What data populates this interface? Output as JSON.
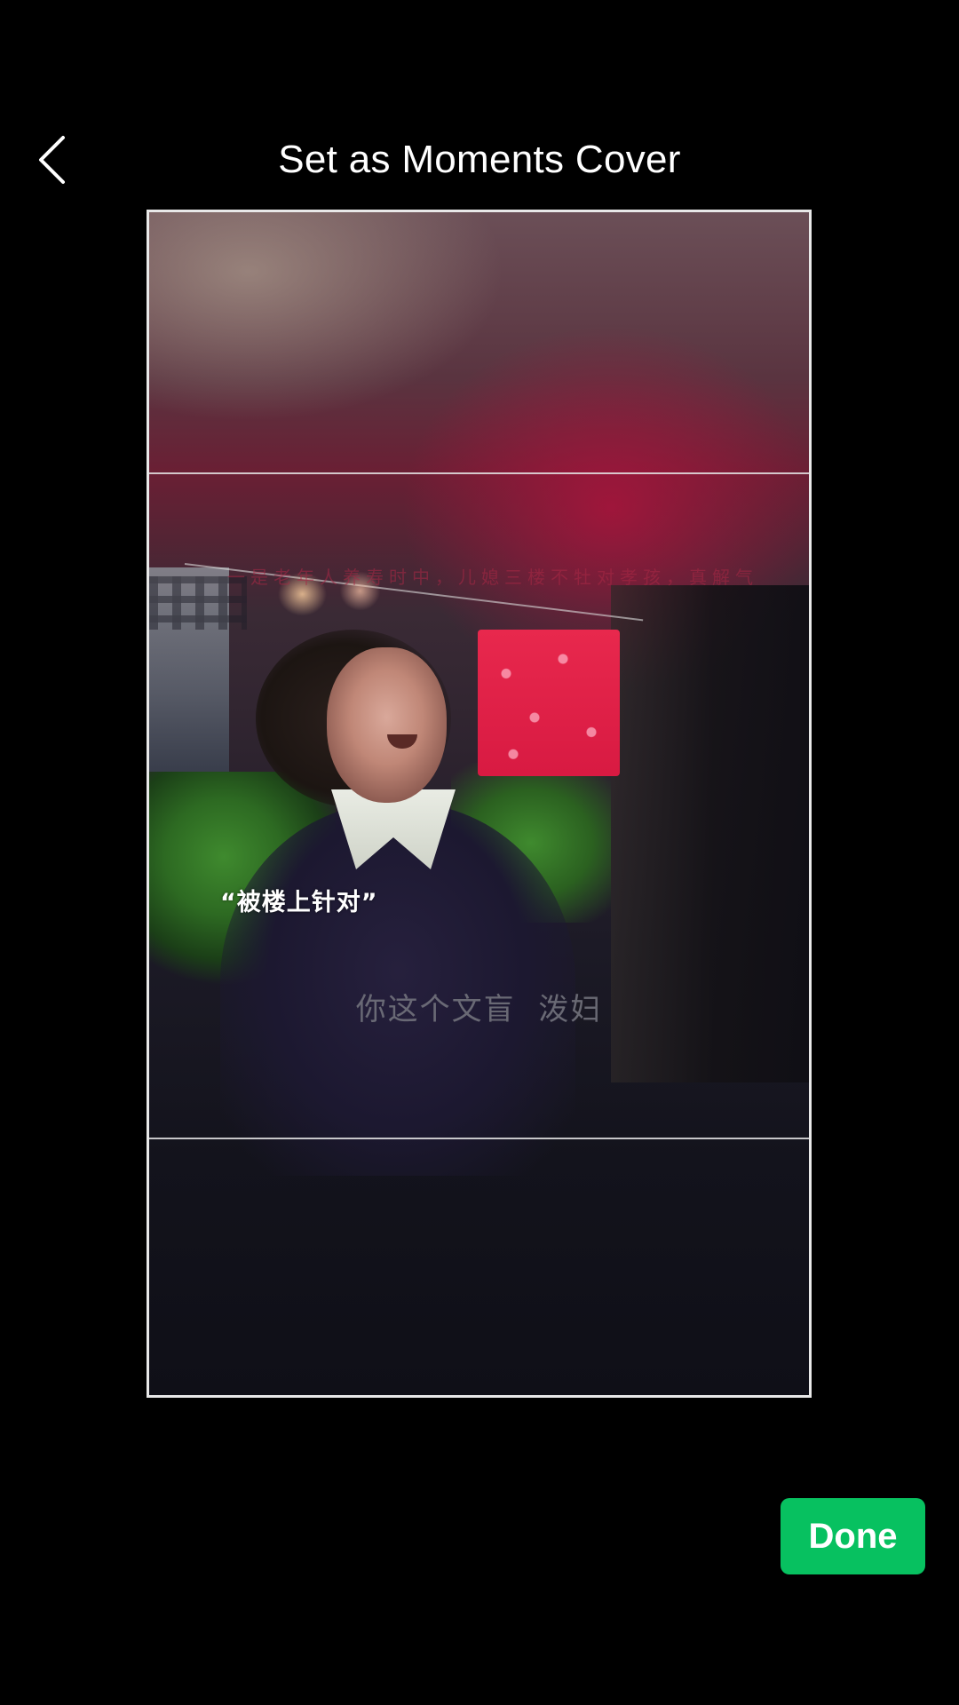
{
  "header": {
    "title": "Set as Moments Cover",
    "back_icon": "chevron-left-icon"
  },
  "photo": {
    "faded_caption": "一是老年人养寿时中，儿媳三楼不牡对孝孩，真解气",
    "sticker_text": "“被楼上针对”",
    "subtitle": "你这个文盲  泼妇"
  },
  "footer": {
    "done_label": "Done"
  },
  "colors": {
    "background": "#000000",
    "accent": "#07c160",
    "frame": "#e8e8e8",
    "text": "#ffffff"
  }
}
